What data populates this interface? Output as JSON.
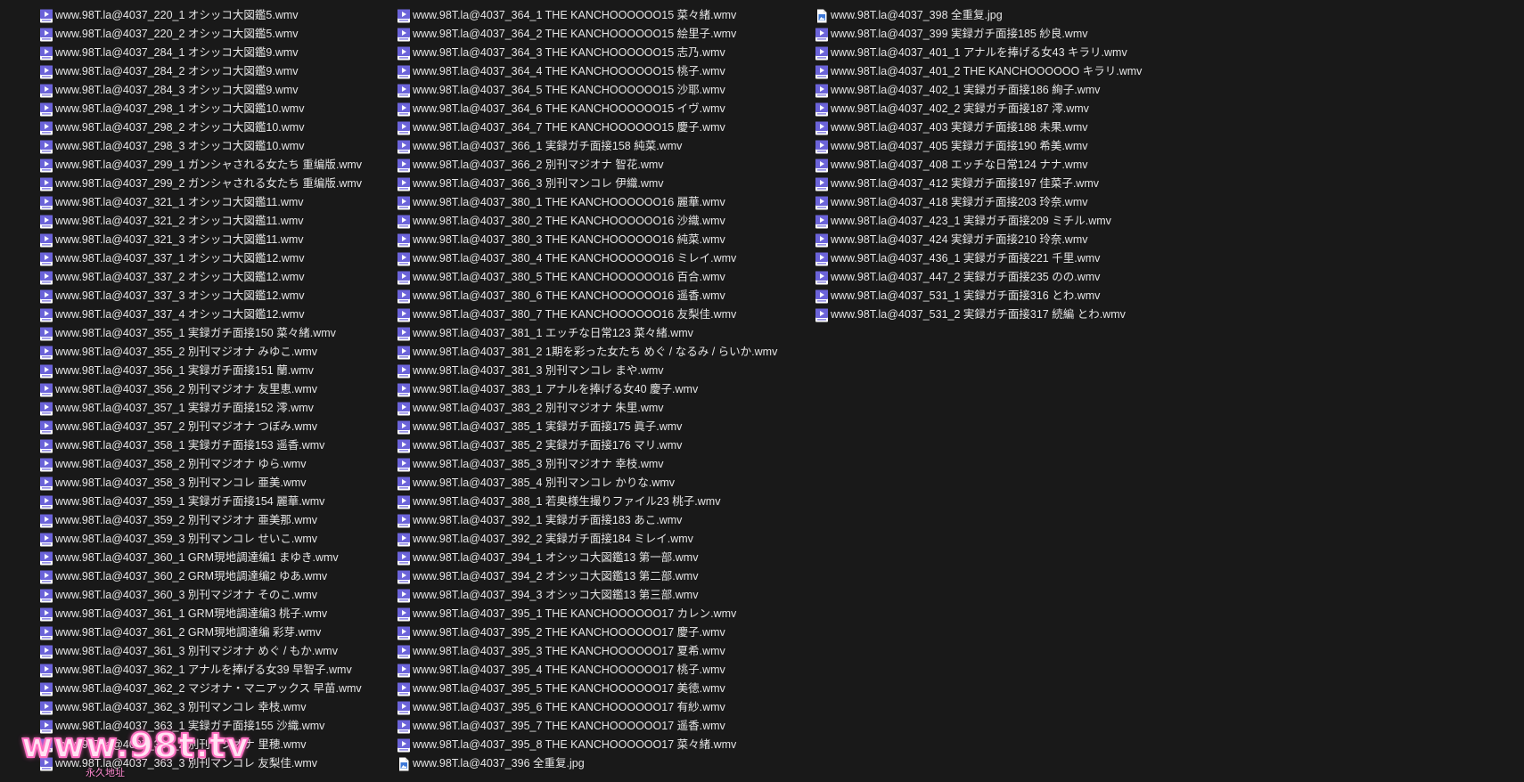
{
  "icon_colors": {
    "video": "#6b63d9",
    "image": "#3d78d8"
  },
  "columns": [
    [
      {
        "icon": "video-file-icon",
        "name": "www.98T.la@4037_220_1 オシッコ大図鑑5.wmv"
      },
      {
        "icon": "video-file-icon",
        "name": "www.98T.la@4037_220_2 オシッコ大図鑑5.wmv"
      },
      {
        "icon": "video-file-icon",
        "name": "www.98T.la@4037_284_1 オシッコ大図鑑9.wmv"
      },
      {
        "icon": "video-file-icon",
        "name": "www.98T.la@4037_284_2 オシッコ大図鑑9.wmv"
      },
      {
        "icon": "video-file-icon",
        "name": "www.98T.la@4037_284_3 オシッコ大図鑑9.wmv"
      },
      {
        "icon": "video-file-icon",
        "name": "www.98T.la@4037_298_1 オシッコ大図鑑10.wmv"
      },
      {
        "icon": "video-file-icon",
        "name": "www.98T.la@4037_298_2 オシッコ大図鑑10.wmv"
      },
      {
        "icon": "video-file-icon",
        "name": "www.98T.la@4037_298_3 オシッコ大図鑑10.wmv"
      },
      {
        "icon": "video-file-icon",
        "name": "www.98T.la@4037_299_1 ガンシャされる女たち 重编版.wmv"
      },
      {
        "icon": "video-file-icon",
        "name": "www.98T.la@4037_299_2 ガンシャされる女たち 重编版.wmv"
      },
      {
        "icon": "video-file-icon",
        "name": "www.98T.la@4037_321_1 オシッコ大図鑑11.wmv"
      },
      {
        "icon": "video-file-icon",
        "name": "www.98T.la@4037_321_2 オシッコ大図鑑11.wmv"
      },
      {
        "icon": "video-file-icon",
        "name": "www.98T.la@4037_321_3 オシッコ大図鑑11.wmv"
      },
      {
        "icon": "video-file-icon",
        "name": "www.98T.la@4037_337_1 オシッコ大図鑑12.wmv"
      },
      {
        "icon": "video-file-icon",
        "name": "www.98T.la@4037_337_2 オシッコ大図鑑12.wmv"
      },
      {
        "icon": "video-file-icon",
        "name": "www.98T.la@4037_337_3 オシッコ大図鑑12.wmv"
      },
      {
        "icon": "video-file-icon",
        "name": "www.98T.la@4037_337_4 オシッコ大図鑑12.wmv"
      },
      {
        "icon": "video-file-icon",
        "name": "www.98T.la@4037_355_1 実録ガチ面接150 菜々緒.wmv"
      },
      {
        "icon": "video-file-icon",
        "name": "www.98T.la@4037_355_2 別刊マジオナ みゆこ.wmv"
      },
      {
        "icon": "video-file-icon",
        "name": "www.98T.la@4037_356_1 実録ガチ面接151 蘭.wmv"
      },
      {
        "icon": "video-file-icon",
        "name": "www.98T.la@4037_356_2 別刊マジオナ 友里恵.wmv"
      },
      {
        "icon": "video-file-icon",
        "name": "www.98T.la@4037_357_1 実録ガチ面接152 澪.wmv"
      },
      {
        "icon": "video-file-icon",
        "name": "www.98T.la@4037_357_2 別刊マジオナ つぼみ.wmv"
      },
      {
        "icon": "video-file-icon",
        "name": "www.98T.la@4037_358_1 実録ガチ面接153 遥香.wmv"
      },
      {
        "icon": "video-file-icon",
        "name": "www.98T.la@4037_358_2 別刊マジオナ ゆら.wmv"
      },
      {
        "icon": "video-file-icon",
        "name": "www.98T.la@4037_358_3 別刊マンコレ 亜美.wmv"
      },
      {
        "icon": "video-file-icon",
        "name": "www.98T.la@4037_359_1 実録ガチ面接154 麗華.wmv"
      },
      {
        "icon": "video-file-icon",
        "name": "www.98T.la@4037_359_2 別刊マジオナ 亜美那.wmv"
      },
      {
        "icon": "video-file-icon",
        "name": "www.98T.la@4037_359_3 別刊マンコレ せいこ.wmv"
      },
      {
        "icon": "video-file-icon",
        "name": "www.98T.la@4037_360_1 GRM現地調達编1 まゆき.wmv"
      },
      {
        "icon": "video-file-icon",
        "name": "www.98T.la@4037_360_2 GRM現地調達编2 ゆあ.wmv"
      },
      {
        "icon": "video-file-icon",
        "name": "www.98T.la@4037_360_3 別刊マジオナ そのこ.wmv"
      },
      {
        "icon": "video-file-icon",
        "name": "www.98T.la@4037_361_1 GRM現地調達编3 桃子.wmv"
      },
      {
        "icon": "video-file-icon",
        "name": "www.98T.la@4037_361_2 GRM現地調達编 彩芽.wmv"
      },
      {
        "icon": "video-file-icon",
        "name": "www.98T.la@4037_361_3 別刊マジオナ めぐ / もか.wmv"
      },
      {
        "icon": "video-file-icon",
        "name": "www.98T.la@4037_362_1 アナルを捧げる女39 早智子.wmv"
      },
      {
        "icon": "video-file-icon",
        "name": "www.98T.la@4037_362_2 マジオナ・マニアックス 早苗.wmv"
      },
      {
        "icon": "video-file-icon",
        "name": "www.98T.la@4037_362_3 別刊マンコレ 幸枝.wmv"
      },
      {
        "icon": "video-file-icon",
        "name": "www.98T.la@4037_363_1 実録ガチ面接155 沙織.wmv"
      },
      {
        "icon": "video-file-icon",
        "name": "www.98T.la@4037_363_2 別刊マジオナ 里穂.wmv"
      },
      {
        "icon": "video-file-icon",
        "name": "www.98T.la@4037_363_3 別刊マンコレ 友梨佳.wmv"
      }
    ],
    [
      {
        "icon": "video-file-icon",
        "name": "www.98T.la@4037_364_1 THE KANCHOOOOOO15 菜々緒.wmv"
      },
      {
        "icon": "video-file-icon",
        "name": "www.98T.la@4037_364_2 THE KANCHOOOOOO15 絵里子.wmv"
      },
      {
        "icon": "video-file-icon",
        "name": "www.98T.la@4037_364_3 THE KANCHOOOOOO15 志乃.wmv"
      },
      {
        "icon": "video-file-icon",
        "name": "www.98T.la@4037_364_4 THE KANCHOOOOOO15 桃子.wmv"
      },
      {
        "icon": "video-file-icon",
        "name": "www.98T.la@4037_364_5 THE KANCHOOOOOO15 沙耶.wmv"
      },
      {
        "icon": "video-file-icon",
        "name": "www.98T.la@4037_364_6 THE KANCHOOOOOO15 イヴ.wmv"
      },
      {
        "icon": "video-file-icon",
        "name": "www.98T.la@4037_364_7 THE KANCHOOOOOO15 慶子.wmv"
      },
      {
        "icon": "video-file-icon",
        "name": "www.98T.la@4037_366_1 実録ガチ面接158 純菜.wmv"
      },
      {
        "icon": "video-file-icon",
        "name": "www.98T.la@4037_366_2 別刊マジオナ 智花.wmv"
      },
      {
        "icon": "video-file-icon",
        "name": "www.98T.la@4037_366_3 別刊マンコレ 伊織.wmv"
      },
      {
        "icon": "video-file-icon",
        "name": "www.98T.la@4037_380_1 THE KANCHOOOOOO16 麗華.wmv"
      },
      {
        "icon": "video-file-icon",
        "name": "www.98T.la@4037_380_2 THE KANCHOOOOOO16 沙織.wmv"
      },
      {
        "icon": "video-file-icon",
        "name": "www.98T.la@4037_380_3 THE KANCHOOOOOO16 純菜.wmv"
      },
      {
        "icon": "video-file-icon",
        "name": "www.98T.la@4037_380_4 THE KANCHOOOOOO16 ミレイ.wmv"
      },
      {
        "icon": "video-file-icon",
        "name": "www.98T.la@4037_380_5 THE KANCHOOOOOO16 百合.wmv"
      },
      {
        "icon": "video-file-icon",
        "name": "www.98T.la@4037_380_6 THE KANCHOOOOOO16 遥香.wmv"
      },
      {
        "icon": "video-file-icon",
        "name": "www.98T.la@4037_380_7 THE KANCHOOOOOO16 友梨佳.wmv"
      },
      {
        "icon": "video-file-icon",
        "name": "www.98T.la@4037_381_1 エッチな日常123 菜々緒.wmv"
      },
      {
        "icon": "video-file-icon",
        "name": "www.98T.la@4037_381_2 1期を彩った女たち めぐ / なるみ / らいか.wmv"
      },
      {
        "icon": "video-file-icon",
        "name": "www.98T.la@4037_381_3 別刊マンコレ まや.wmv"
      },
      {
        "icon": "video-file-icon",
        "name": "www.98T.la@4037_383_1 アナルを捧げる女40 慶子.wmv"
      },
      {
        "icon": "video-file-icon",
        "name": "www.98T.la@4037_383_2 別刊マジオナ 朱里.wmv"
      },
      {
        "icon": "video-file-icon",
        "name": "www.98T.la@4037_385_1 実録ガチ面接175 眞子.wmv"
      },
      {
        "icon": "video-file-icon",
        "name": "www.98T.la@4037_385_2 実録ガチ面接176 マリ.wmv"
      },
      {
        "icon": "video-file-icon",
        "name": "www.98T.la@4037_385_3 別刊マジオナ 幸枝.wmv"
      },
      {
        "icon": "video-file-icon",
        "name": "www.98T.la@4037_385_4 別刊マンコレ かりな.wmv"
      },
      {
        "icon": "video-file-icon",
        "name": "www.98T.la@4037_388_1 若奥様生撮りファイル23 桃子.wmv"
      },
      {
        "icon": "video-file-icon",
        "name": "www.98T.la@4037_392_1 実録ガチ面接183 あこ.wmv"
      },
      {
        "icon": "video-file-icon",
        "name": "www.98T.la@4037_392_2 実録ガチ面接184 ミレイ.wmv"
      },
      {
        "icon": "video-file-icon",
        "name": "www.98T.la@4037_394_1 オシッコ大図鑑13 第一部.wmv"
      },
      {
        "icon": "video-file-icon",
        "name": "www.98T.la@4037_394_2 オシッコ大図鑑13 第二部.wmv"
      },
      {
        "icon": "video-file-icon",
        "name": "www.98T.la@4037_394_3 オシッコ大図鑑13 第三部.wmv"
      },
      {
        "icon": "video-file-icon",
        "name": "www.98T.la@4037_395_1 THE KANCHOOOOOO17 カレン.wmv"
      },
      {
        "icon": "video-file-icon",
        "name": "www.98T.la@4037_395_2 THE KANCHOOOOOO17 慶子.wmv"
      },
      {
        "icon": "video-file-icon",
        "name": "www.98T.la@4037_395_3 THE KANCHOOOOOO17 夏希.wmv"
      },
      {
        "icon": "video-file-icon",
        "name": "www.98T.la@4037_395_4 THE KANCHOOOOOO17 桃子.wmv"
      },
      {
        "icon": "video-file-icon",
        "name": "www.98T.la@4037_395_5 THE KANCHOOOOOO17 美徳.wmv"
      },
      {
        "icon": "video-file-icon",
        "name": "www.98T.la@4037_395_6 THE KANCHOOOOOO17 有紗.wmv"
      },
      {
        "icon": "video-file-icon",
        "name": "www.98T.la@4037_395_7 THE KANCHOOOOOO17 遥香.wmv"
      },
      {
        "icon": "video-file-icon",
        "name": "www.98T.la@4037_395_8 THE KANCHOOOOOO17 菜々緒.wmv"
      },
      {
        "icon": "image-file-icon",
        "name": "www.98T.la@4037_396 全重复.jpg"
      }
    ],
    [
      {
        "icon": "image-file-icon",
        "name": "www.98T.la@4037_398 全重复.jpg"
      },
      {
        "icon": "video-file-icon",
        "name": "www.98T.la@4037_399 実録ガチ面接185 紗良.wmv"
      },
      {
        "icon": "video-file-icon",
        "name": "www.98T.la@4037_401_1 アナルを捧げる女43 キラリ.wmv"
      },
      {
        "icon": "video-file-icon",
        "name": "www.98T.la@4037_401_2 THE KANCHOOOOOO キラリ.wmv"
      },
      {
        "icon": "video-file-icon",
        "name": "www.98T.la@4037_402_1 実録ガチ面接186 絢子.wmv"
      },
      {
        "icon": "video-file-icon",
        "name": "www.98T.la@4037_402_2 実録ガチ面接187 澪.wmv"
      },
      {
        "icon": "video-file-icon",
        "name": "www.98T.la@4037_403 実録ガチ面接188 未果.wmv"
      },
      {
        "icon": "video-file-icon",
        "name": "www.98T.la@4037_405 実録ガチ面接190 希美.wmv"
      },
      {
        "icon": "video-file-icon",
        "name": "www.98T.la@4037_408 エッチな日常124 ナナ.wmv"
      },
      {
        "icon": "video-file-icon",
        "name": "www.98T.la@4037_412 実録ガチ面接197 佳菜子.wmv"
      },
      {
        "icon": "video-file-icon",
        "name": "www.98T.la@4037_418 実録ガチ面接203 玲奈.wmv"
      },
      {
        "icon": "video-file-icon",
        "name": "www.98T.la@4037_423_1 実録ガチ面接209 ミチル.wmv"
      },
      {
        "icon": "video-file-icon",
        "name": "www.98T.la@4037_424 実録ガチ面接210 玲奈.wmv"
      },
      {
        "icon": "video-file-icon",
        "name": "www.98T.la@4037_436_1 実録ガチ面接221 千里.wmv"
      },
      {
        "icon": "video-file-icon",
        "name": "www.98T.la@4037_447_2 実録ガチ面接235 のの.wmv"
      },
      {
        "icon": "video-file-icon",
        "name": "www.98T.la@4037_531_1 実録ガチ面接316 とわ.wmv"
      },
      {
        "icon": "video-file-icon",
        "name": "www.98T.la@4037_531_2 実録ガチ面接317 続編 とわ.wmv"
      }
    ]
  ],
  "watermark": {
    "text": "www.98t.tv",
    "subtext": "永久地址"
  }
}
